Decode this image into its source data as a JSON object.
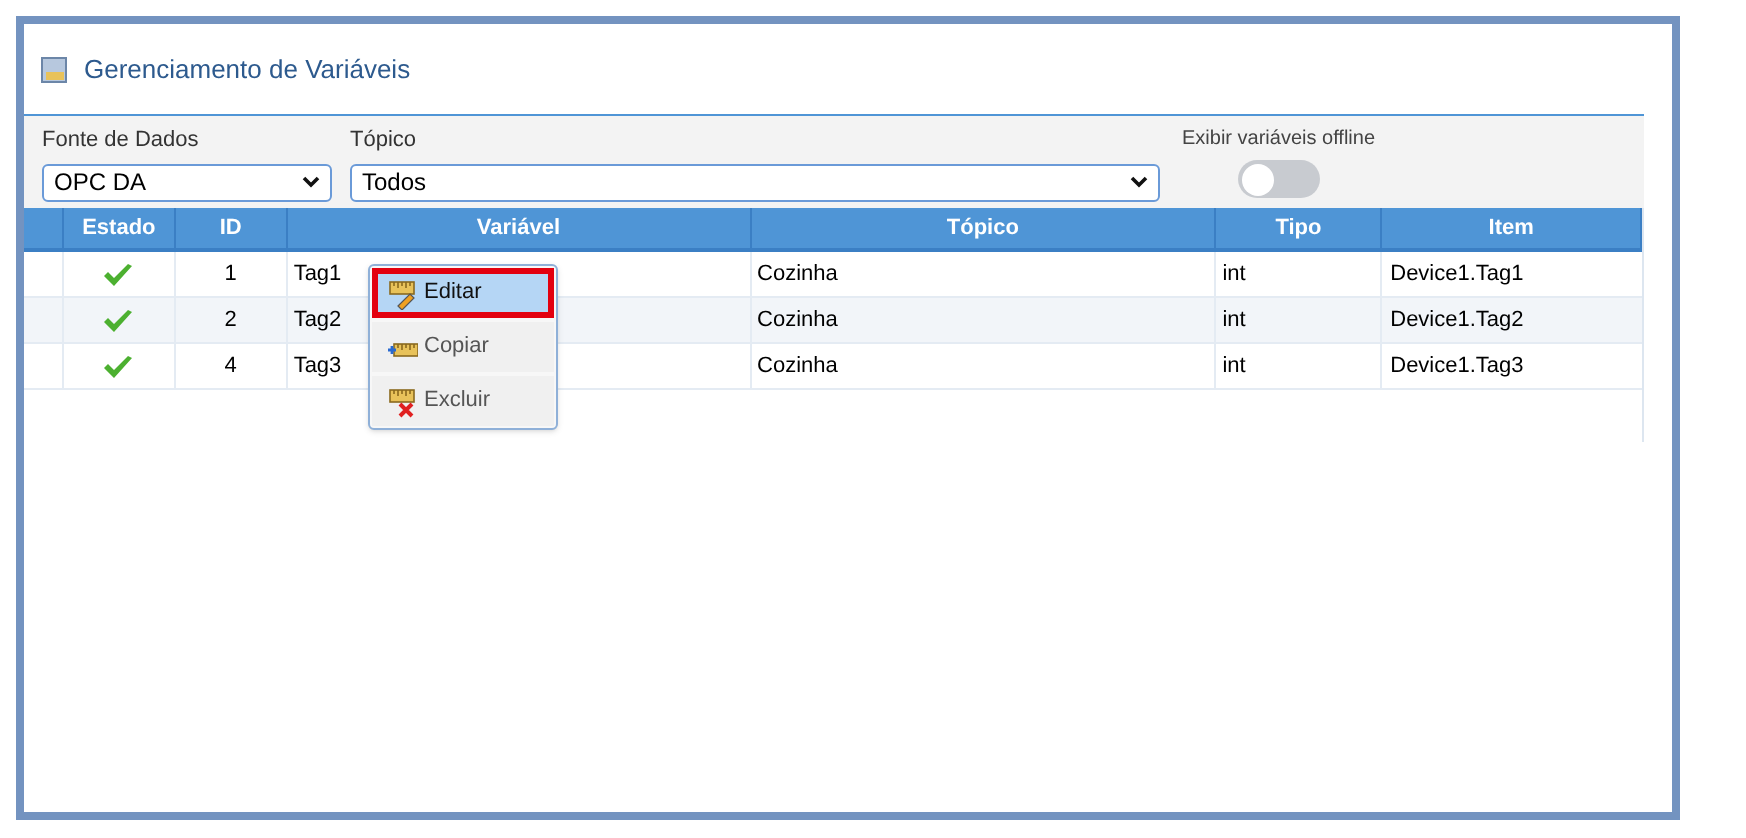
{
  "panel": {
    "title": "Gerenciamento de Variáveis"
  },
  "filters": {
    "data_source": {
      "label": "Fonte de Dados",
      "value": "OPC DA"
    },
    "topic": {
      "label": "Tópico",
      "value": "Todos"
    },
    "offline": {
      "label": "Exibir variáveis offline",
      "on": false
    }
  },
  "table": {
    "columns": [
      "Estado",
      "ID",
      "Variável",
      "Tópico",
      "Tipo",
      "Item"
    ],
    "rows": [
      {
        "online": true,
        "id": "1",
        "variable": "Tag1",
        "topic": "Cozinha",
        "type": "int",
        "item": "Device1.Tag1"
      },
      {
        "online": true,
        "id": "2",
        "variable": "Tag2",
        "topic": "Cozinha",
        "type": "int",
        "item": "Device1.Tag2"
      },
      {
        "online": true,
        "id": "4",
        "variable": "Tag3",
        "topic": "Cozinha",
        "type": "int",
        "item": "Device1.Tag3"
      }
    ]
  },
  "context_menu": {
    "items": [
      {
        "kind": "edit",
        "label": "Editar",
        "selected": true
      },
      {
        "kind": "copy",
        "label": "Copiar",
        "selected": false
      },
      {
        "kind": "delete",
        "label": "Excluir",
        "selected": false
      }
    ]
  }
}
